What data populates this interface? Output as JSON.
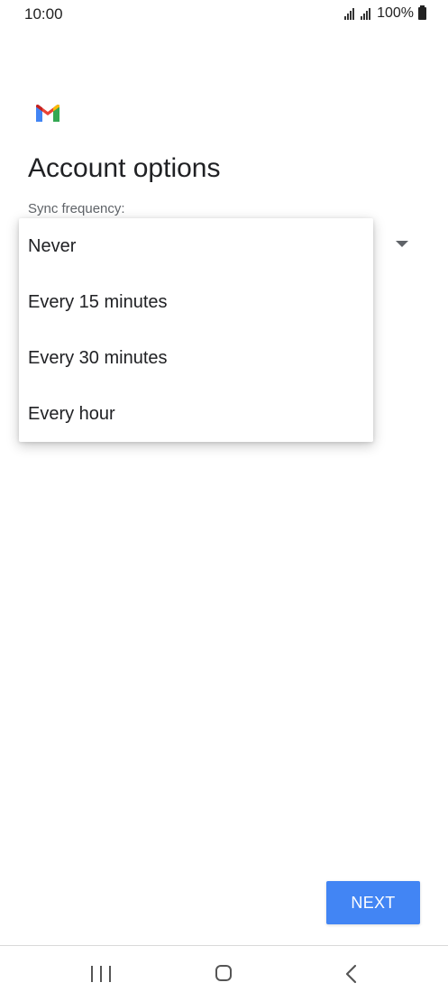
{
  "status_bar": {
    "time": "10:00",
    "battery": "100%"
  },
  "app": {
    "logo_icon": "gmail-m-icon"
  },
  "page": {
    "title": "Account options",
    "sync_label": "Sync frequency:"
  },
  "dropdown": {
    "options": [
      "Never",
      "Every 15 minutes",
      "Every 30 minutes",
      "Every hour"
    ]
  },
  "actions": {
    "next_label": "NEXT",
    "next_color": "#4285f4"
  },
  "nav_bar": {
    "recents_icon": "recents-icon",
    "home_icon": "home-icon",
    "back_icon": "back-icon"
  }
}
